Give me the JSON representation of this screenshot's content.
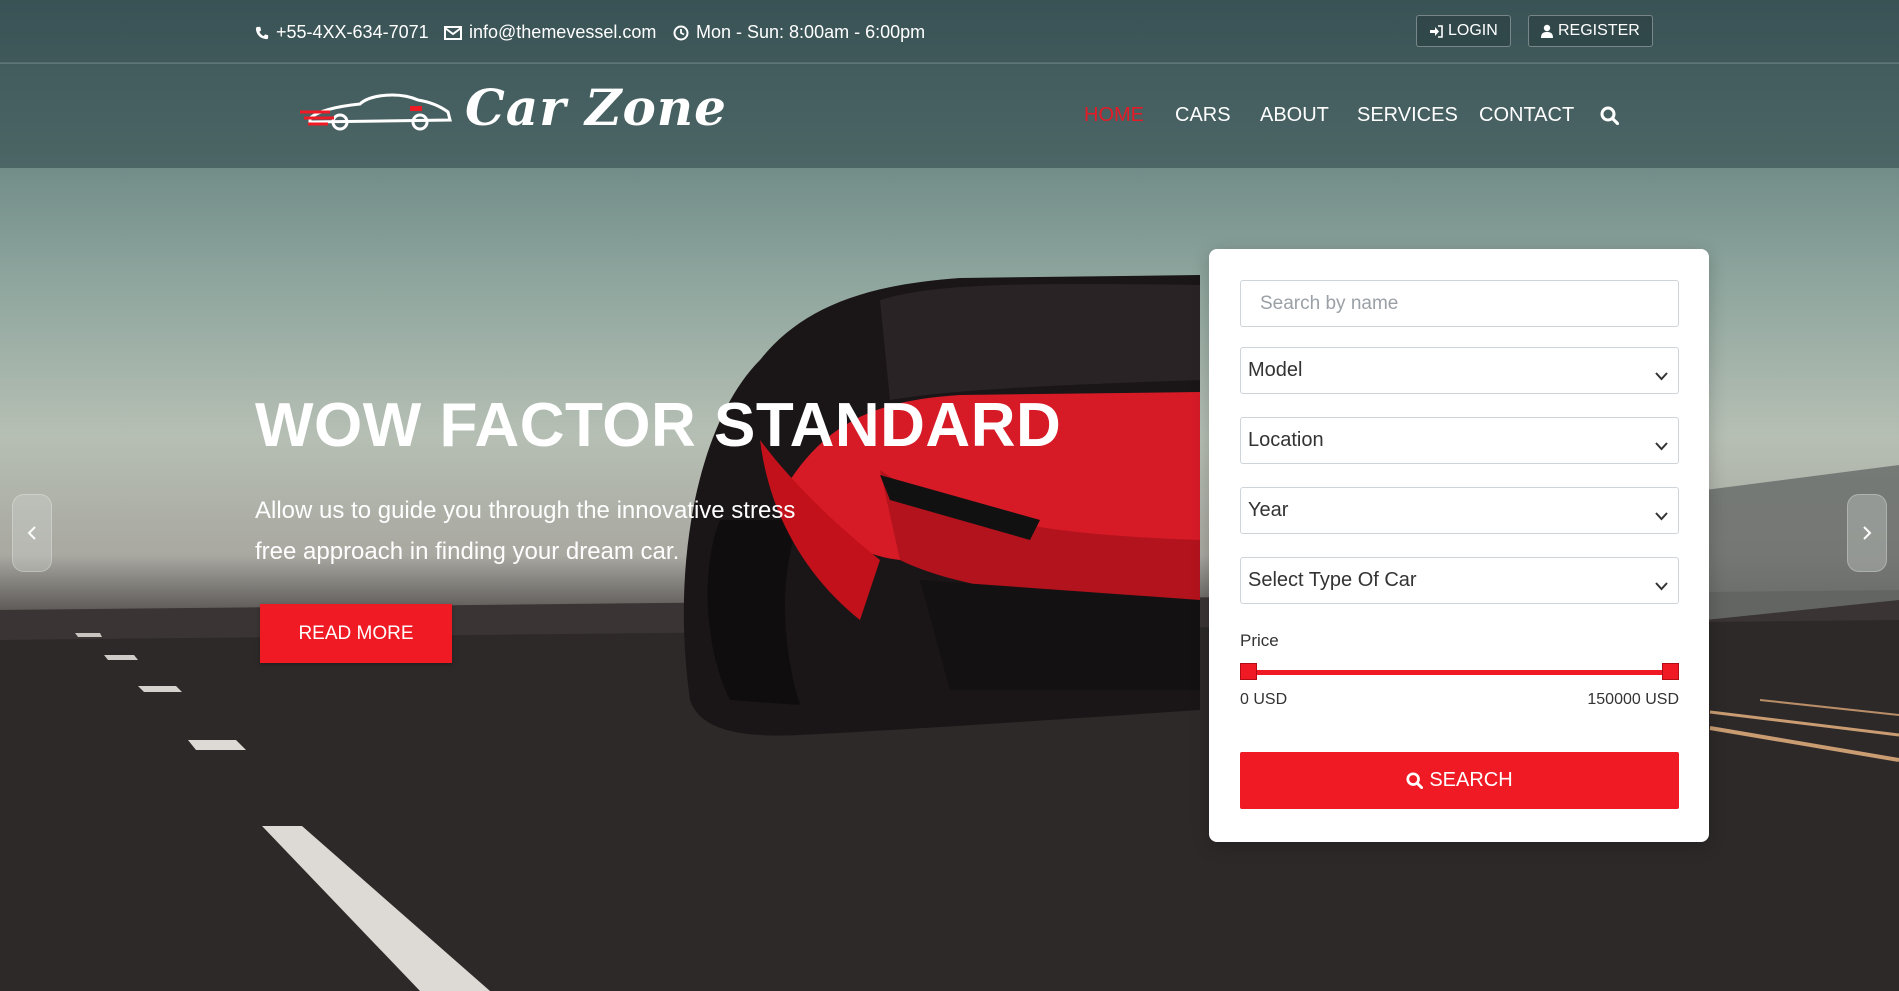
{
  "topbar": {
    "phone": "+55-4XX-634-7071",
    "email": "info@themevessel.com",
    "hours": "Mon - Sun: 8:00am - 6:00pm",
    "login_label": "LOGIN",
    "register_label": "REGISTER",
    "phone_icon": "phone-icon",
    "email_icon": "envelope-icon",
    "hours_icon": "clock-icon"
  },
  "brand": {
    "name": "Car Zone",
    "logo_icon": "car-silhouette-icon"
  },
  "nav": {
    "items": [
      "HOME",
      "CARS",
      "ABOUT",
      "SERVICES",
      "CONTACT"
    ],
    "active": "HOME",
    "search_icon": "search-icon"
  },
  "hero": {
    "headline": "WOW FACTOR STANDARD",
    "subtext": "Allow us to guide you through the innovative stress free approach in finding your dream car.",
    "read_more_label": "READ MORE",
    "prev_icon": "chevron-left-icon",
    "next_icon": "chevron-right-icon"
  },
  "search_panel": {
    "name_placeholder": "Search by name",
    "model_value": "Model",
    "location_value": "Location",
    "year_value": "Year",
    "type_value": "Select Type Of Car",
    "price_label": "Price",
    "price_min": "0 USD",
    "price_max": "150000 USD",
    "price_range_fraction": [
      0,
      1
    ],
    "search_label": "SEARCH"
  },
  "colors": {
    "accent": "#ef1a24",
    "panel_bg": "#ffffff",
    "nav_active": "#e41a26"
  }
}
